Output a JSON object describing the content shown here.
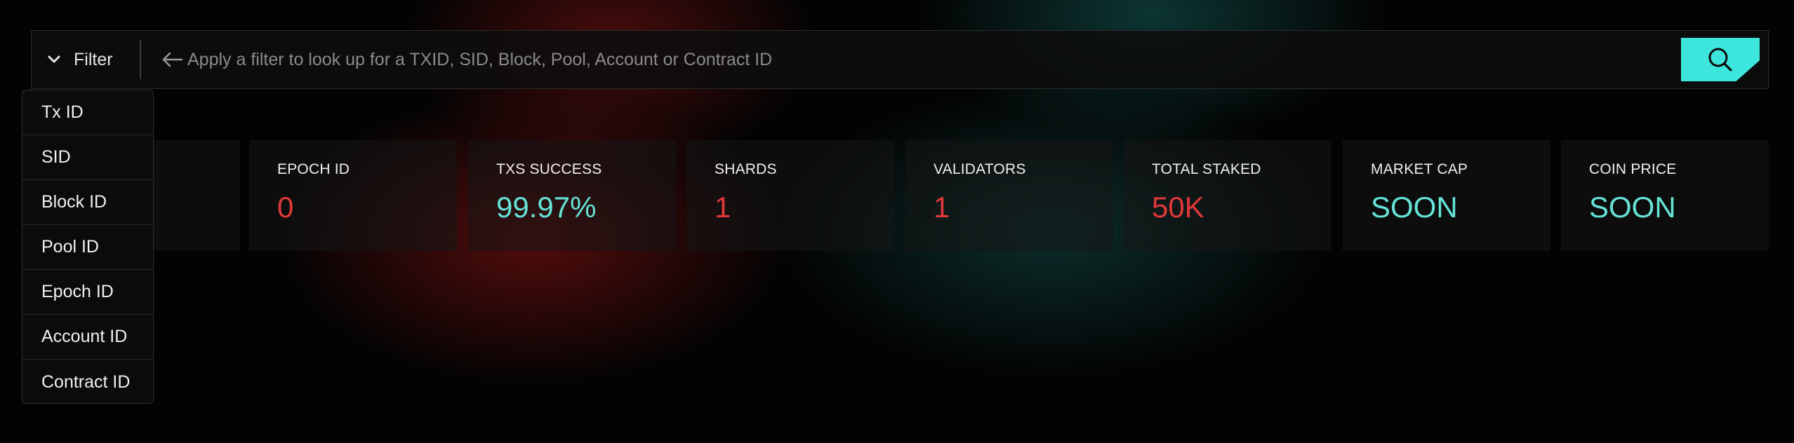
{
  "search": {
    "filter_label": "Filter",
    "placeholder": "Apply a filter to look up for a TXID, SID, Block, Pool, Account or Contract ID"
  },
  "filter_options": [
    "Tx ID",
    "SID",
    "Block ID",
    "Pool ID",
    "Epoch ID",
    "Account ID",
    "Contract ID"
  ],
  "stats": [
    {
      "label": "EPOCH ID",
      "value": "0",
      "color": "red"
    },
    {
      "label": "TXS SUCCESS",
      "value": "99.97%",
      "color": "teal"
    },
    {
      "label": "SHARDS",
      "value": "1",
      "color": "red"
    },
    {
      "label": "VALIDATORS",
      "value": "1",
      "color": "red"
    },
    {
      "label": "TOTAL STAKED",
      "value": "50K",
      "color": "red"
    },
    {
      "label": "MARKET CAP",
      "value": "SOON",
      "color": "teal"
    },
    {
      "label": "COIN PRICE",
      "value": "SOON",
      "color": "teal"
    }
  ],
  "colors": {
    "accent_teal": "#3de6dc",
    "value_red": "#e0383a",
    "value_teal": "#66e3d7"
  },
  "icons": {
    "filter_toggle": "chevron-down-icon",
    "input_hint": "arrow-left-icon",
    "search": "search-icon"
  }
}
